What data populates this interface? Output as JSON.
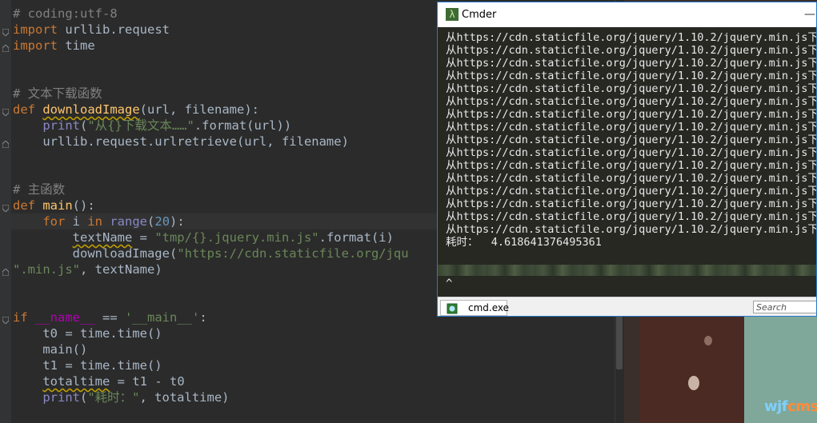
{
  "editor": {
    "lines": [
      [
        {
          "t": "# coding:utf-8",
          "c": "cm"
        }
      ],
      [
        {
          "t": "import",
          "c": "kw"
        },
        {
          "t": " urllib.request"
        }
      ],
      [
        {
          "t": "import",
          "c": "kw"
        },
        {
          "t": " time"
        }
      ],
      [],
      [],
      [
        {
          "t": "# 文本下载函数",
          "c": "cm"
        }
      ],
      [
        {
          "t": "def",
          "c": "kw"
        },
        {
          "t": " "
        },
        {
          "t": "downloadImage",
          "c": "fn wavy"
        },
        {
          "t": "(url, filename):"
        }
      ],
      [
        {
          "t": "    "
        },
        {
          "t": "print",
          "c": "bi"
        },
        {
          "t": "("
        },
        {
          "t": "\"从{}下载文本……\"",
          "c": "st"
        },
        {
          "t": ".format(url))"
        }
      ],
      [
        {
          "t": "    urllib.request.urlretrieve(url, filename)"
        }
      ],
      [],
      [],
      [
        {
          "t": "# 主函数",
          "c": "cm"
        }
      ],
      [
        {
          "t": "def",
          "c": "kw"
        },
        {
          "t": " "
        },
        {
          "t": "main",
          "c": "fn"
        },
        {
          "t": "():"
        }
      ],
      [
        {
          "t": "    "
        },
        {
          "t": "for",
          "c": "kw"
        },
        {
          "t": " i "
        },
        {
          "t": "in",
          "c": "kw"
        },
        {
          "t": " "
        },
        {
          "t": "range",
          "c": "bi"
        },
        {
          "t": "("
        },
        {
          "t": "20",
          "c": "nm"
        },
        {
          "t": "):"
        }
      ],
      [
        {
          "t": "        "
        },
        {
          "t": "textName",
          "c": "wavy"
        },
        {
          "t": " = "
        },
        {
          "t": "\"tmp/{}.jquery.min.js\"",
          "c": "st"
        },
        {
          "t": ".format(i)"
        }
      ],
      [
        {
          "t": "        downloadImage("
        },
        {
          "t": "\"https://cdn.staticfile.org/jqu",
          "c": "st"
        }
      ],
      [
        {
          "t": "\".min.js\"",
          "c": "st"
        },
        {
          "t": ", textName)"
        }
      ],
      [],
      [],
      [
        {
          "t": "if",
          "c": "kw"
        },
        {
          "t": " "
        },
        {
          "t": "__name__",
          "c": "du"
        },
        {
          "t": " == "
        },
        {
          "t": "'__main__'",
          "c": "st"
        },
        {
          "t": ":"
        }
      ],
      [
        {
          "t": "    t0 = time.time()"
        }
      ],
      [
        {
          "t": "    main()"
        }
      ],
      [
        {
          "t": "    t1 = time.time()"
        }
      ],
      [
        {
          "t": "    "
        },
        {
          "t": "totaltime",
          "c": "wavy"
        },
        {
          "t": " = t1 - t0"
        }
      ],
      [
        {
          "t": "    "
        },
        {
          "t": "print",
          "c": "bi"
        },
        {
          "t": "("
        },
        {
          "t": "\"耗时：\"",
          "c": "st"
        },
        {
          "t": ", totaltime)"
        }
      ]
    ]
  },
  "cmder": {
    "title": "Cmder",
    "app_icon": "λ",
    "min_glyph": "—",
    "console_lines": [
      "从https://cdn.staticfile.org/jquery/1.10.2/jquery.min.js下",
      "从https://cdn.staticfile.org/jquery/1.10.2/jquery.min.js下",
      "从https://cdn.staticfile.org/jquery/1.10.2/jquery.min.js下",
      "从https://cdn.staticfile.org/jquery/1.10.2/jquery.min.js下",
      "从https://cdn.staticfile.org/jquery/1.10.2/jquery.min.js下",
      "从https://cdn.staticfile.org/jquery/1.10.2/jquery.min.js下",
      "从https://cdn.staticfile.org/jquery/1.10.2/jquery.min.js下",
      "从https://cdn.staticfile.org/jquery/1.10.2/jquery.min.js下",
      "从https://cdn.staticfile.org/jquery/1.10.2/jquery.min.js下",
      "从https://cdn.staticfile.org/jquery/1.10.2/jquery.min.js下",
      "从https://cdn.staticfile.org/jquery/1.10.2/jquery.min.js下",
      "从https://cdn.staticfile.org/jquery/1.10.2/jquery.min.js下",
      "从https://cdn.staticfile.org/jquery/1.10.2/jquery.min.js下",
      "从https://cdn.staticfile.org/jquery/1.10.2/jquery.min.js下",
      "从https://cdn.staticfile.org/jquery/1.10.2/jquery.min.js下",
      "从https://cdn.staticfile.org/jquery/1.10.2/jquery.min.js下",
      "耗时：  4.618641376495361"
    ],
    "prompt": "^",
    "tab_label": "cmd.exe",
    "search_placeholder": "Search"
  },
  "watermark": {
    "main": "wjf",
    "accent": "cms"
  }
}
